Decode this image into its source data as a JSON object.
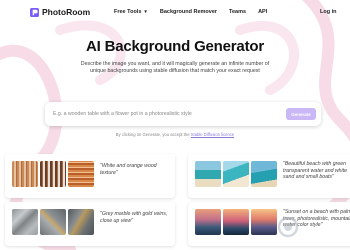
{
  "nav": {
    "brand": "PhotoRoom",
    "links": [
      "Free Tools",
      "Background Remover",
      "Teams",
      "API"
    ],
    "login": "Log in"
  },
  "hero": {
    "title": "AI Background Generator",
    "description": "Describe the image you want, and it will magically generate an infinite number of unique backgrounds using stable diffusion that match your exact request"
  },
  "prompt": {
    "placeholder": "E.g. a wooden table with a flower pot in a photorealistic style",
    "button": "Generate"
  },
  "terms": {
    "text": "By clicking on Generate, you accept the",
    "link": "Stable Diffusion licence"
  },
  "examples": [
    {
      "caption": "\"White and orange wood texture\""
    },
    {
      "caption": "\"Beautiful beach with green transparent water and white sand and small boats\""
    },
    {
      "caption": "\"Grey marble with gold veins, close up view\""
    },
    {
      "caption": "\"Sunset on a beach with palm trees, photorealistic, mountain, water color style\""
    }
  ],
  "colors": {
    "accent": "#c9b8f5",
    "link": "#8a7dd8",
    "swirl": "#f6d9e6"
  }
}
